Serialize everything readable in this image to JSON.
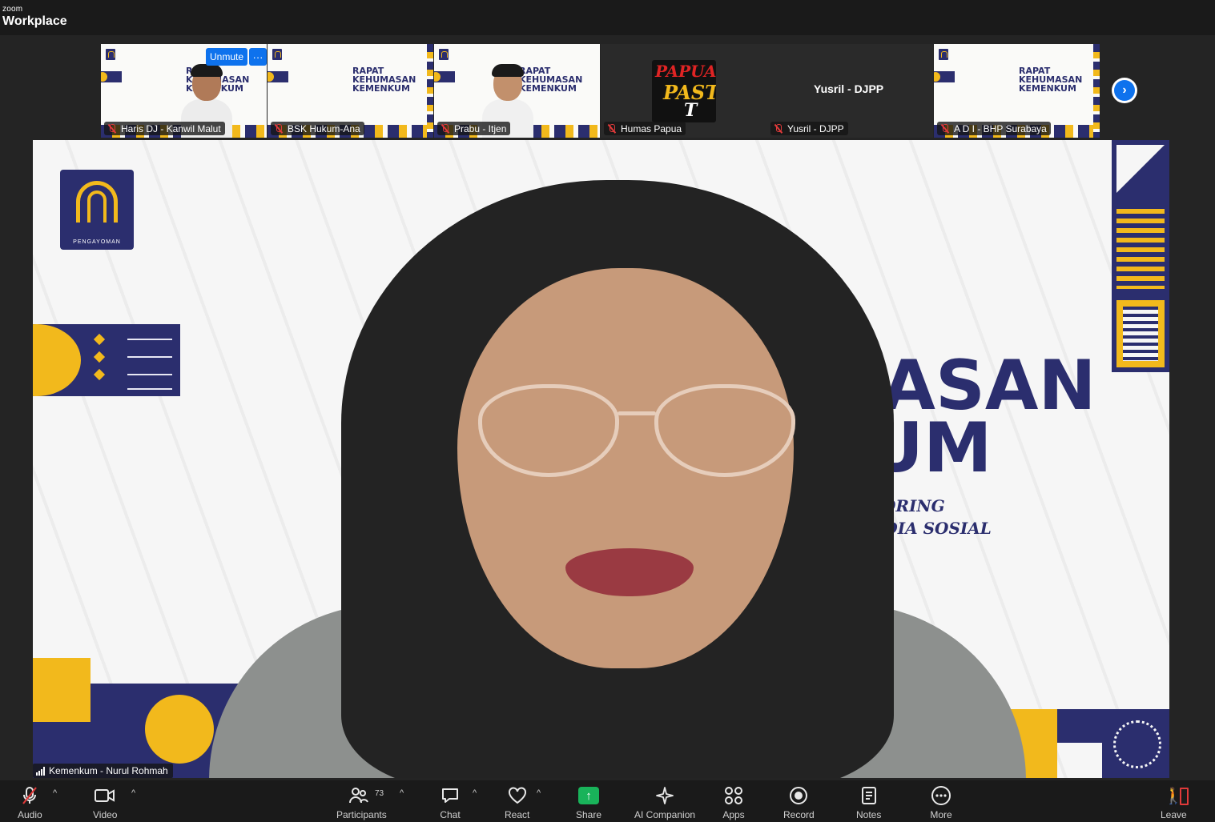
{
  "app": {
    "brand_small": "zoom",
    "brand_name": "Workplace"
  },
  "thumbnails": [
    {
      "name": "Haris DJ - Kanwil Malut",
      "muted": true,
      "slide_title": "RAPAT\nKEHUMASAN\nKEMENKUM",
      "unmute_label": "Unmute",
      "more_label": "···"
    },
    {
      "name": "BSK Hukum-Ana",
      "muted": true,
      "slide_title": "RAPAT\nKEHUMASAN\nKEMENKUM"
    },
    {
      "name": "Prabu - Itjen",
      "muted": true,
      "slide_title": "RAPAT\nKEHUMASAN\nKEMENKUM"
    },
    {
      "name": "Humas Papua",
      "muted": true,
      "center_name": "Yusril - DJPP",
      "second_name": "Yusril - DJPP"
    },
    {
      "name": "A D I - BHP Surabaya",
      "muted": true,
      "slide_title": "RAPAT\nKEHUMASAN\nKEMENKUM"
    }
  ],
  "papua_logo_text": [
    "PAPUA",
    "PAST",
    "T"
  ],
  "main_video": {
    "speaker_name": "Kemenkum - Nurul Rohmah",
    "slide_title": "AT\nUMASAN\nNKUM",
    "slide_sub": "ONITORING\n& MEDIA SOSIAL",
    "logo_caption": "PENGAYOMAN"
  },
  "toolbar": {
    "audio": "Audio",
    "video": "Video",
    "participants": "Participants",
    "participants_count": "73",
    "chat": "Chat",
    "react": "React",
    "share": "Share",
    "ai_companion": "AI Companion",
    "apps": "Apps",
    "record": "Record",
    "notes": "Notes",
    "more": "More",
    "leave": "Leave"
  },
  "colors": {
    "navy": "#2b2e6e",
    "gold": "#f2b91c",
    "zoom_blue": "#0e72ed",
    "share_green": "#19b35a",
    "muted_red": "#e03a3a"
  }
}
